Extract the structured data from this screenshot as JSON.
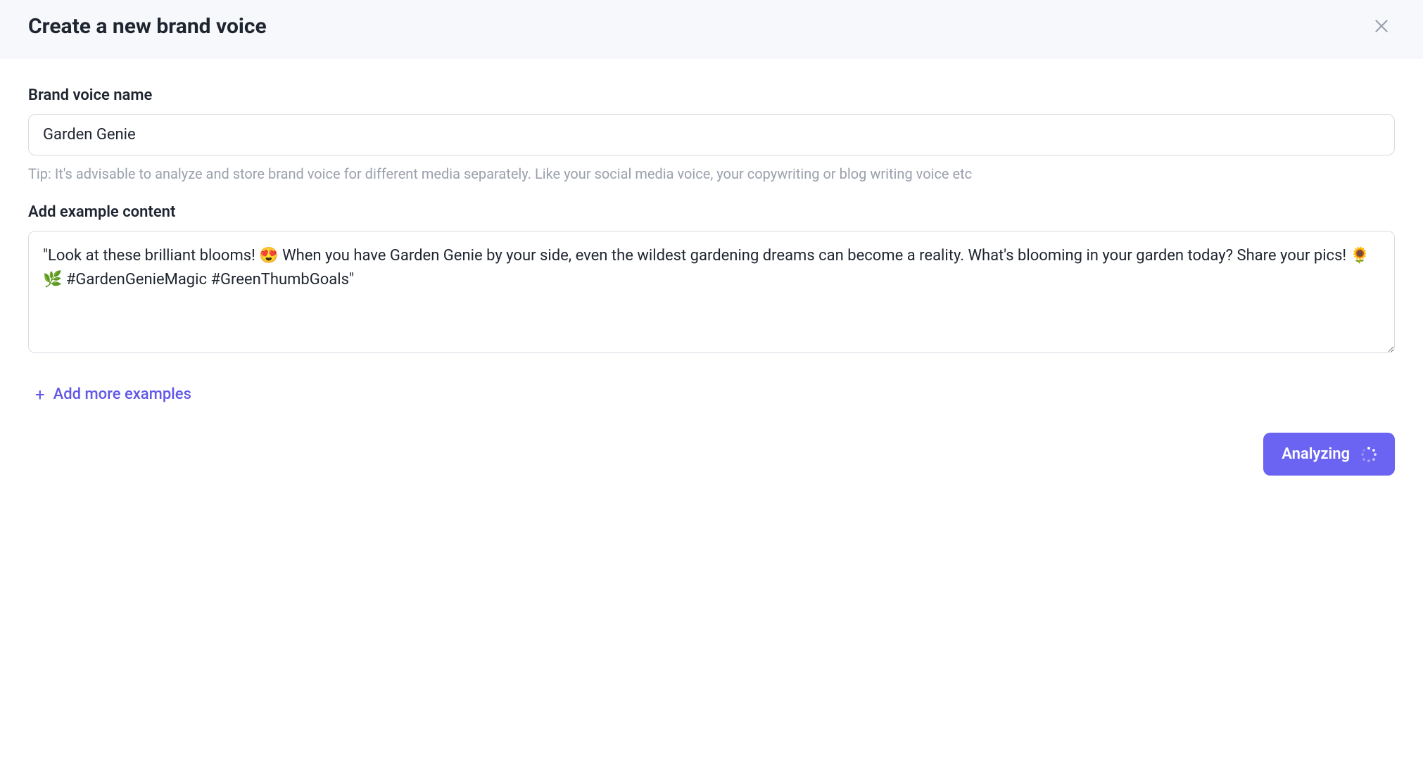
{
  "header": {
    "title": "Create a new brand voice"
  },
  "form": {
    "name_label": "Brand voice name",
    "name_value": "Garden Genie",
    "name_tip": "Tip: It's advisable to analyze and store brand voice for different media separately. Like your social media voice, your copywriting or blog writing voice etc",
    "example_label": "Add example content",
    "example_value": "\"Look at these brilliant blooms! 😍 When you have Garden Genie by your side, even the wildest gardening dreams can become a reality. What's blooming in your garden today? Share your pics! 🌻🌿 #GardenGenieMagic #GreenThumbGoals\"",
    "add_more_label": "Add more examples"
  },
  "footer": {
    "analyze_label": "Analyzing"
  }
}
